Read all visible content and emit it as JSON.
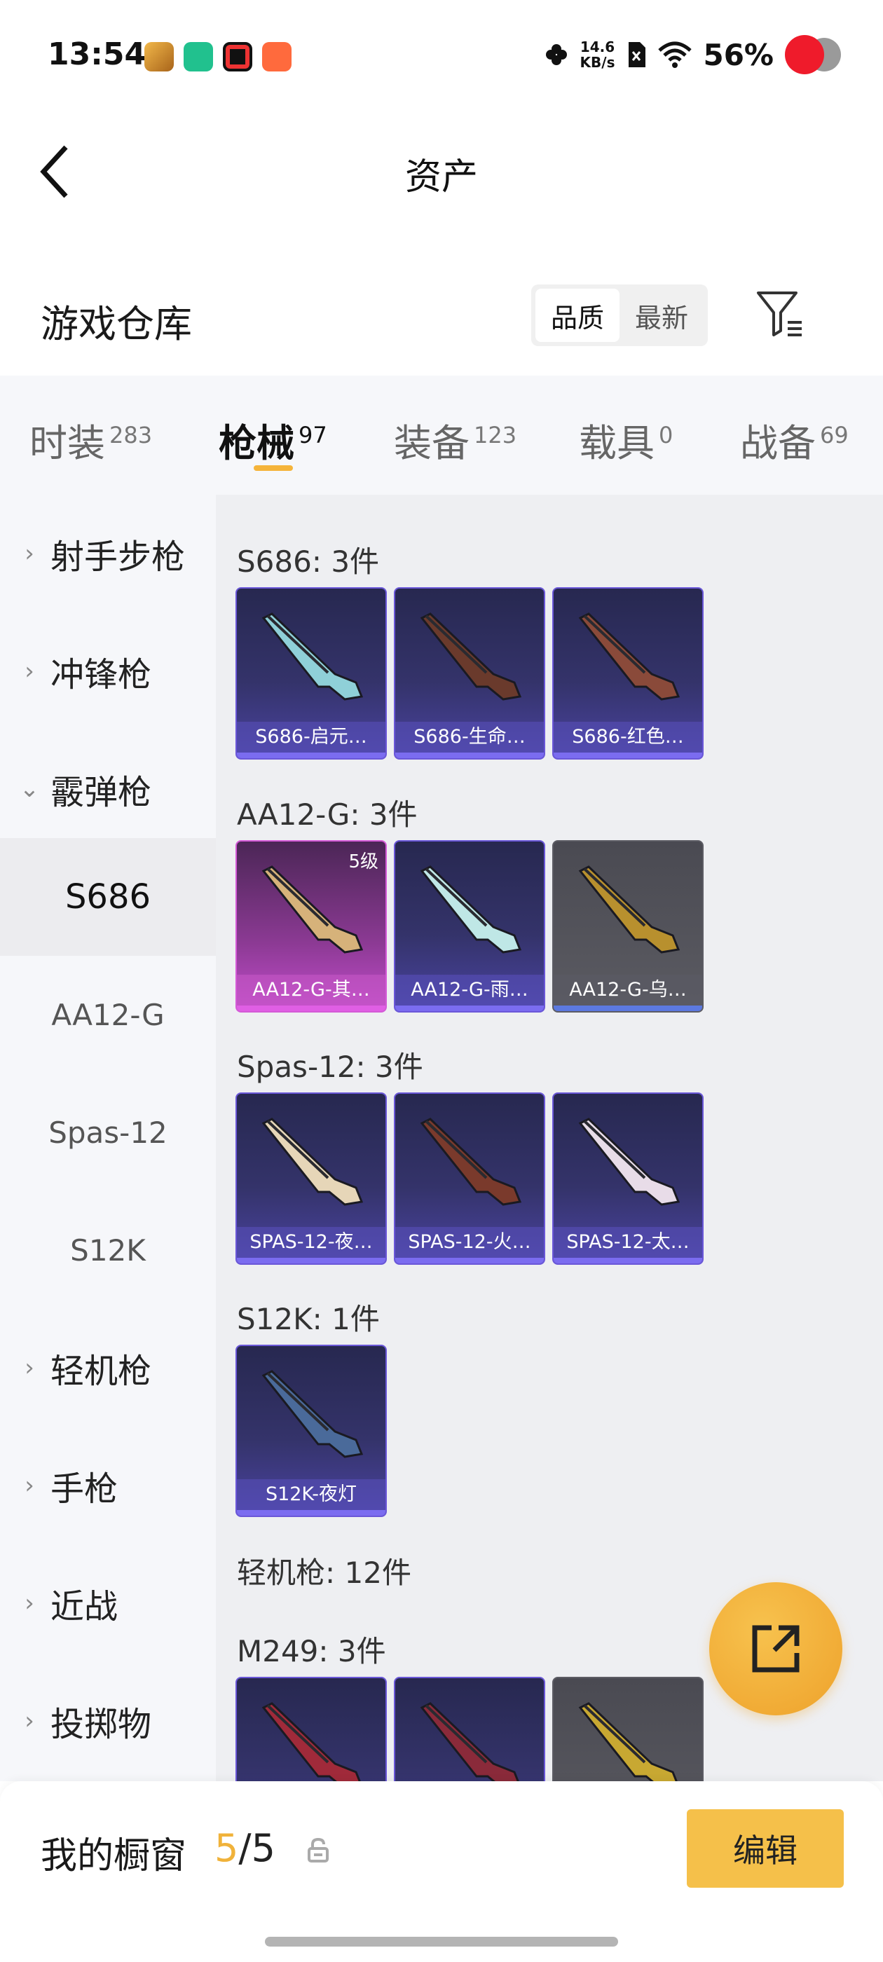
{
  "status_bar": {
    "time": "13:54",
    "net_speed_value": "14.6",
    "net_speed_unit": "KB/s",
    "battery": "56%"
  },
  "header": {
    "title": "资产"
  },
  "warehouse": {
    "title": "游戏仓库",
    "sort_options": [
      "品质",
      "最新"
    ],
    "active_sort": "品质"
  },
  "tabs": [
    {
      "label": "时装",
      "count": "283"
    },
    {
      "label": "枪械",
      "count": "97"
    },
    {
      "label": "装备",
      "count": "123"
    },
    {
      "label": "载具",
      "count": "0"
    },
    {
      "label": "战备",
      "count": "69"
    }
  ],
  "sidebar": {
    "categories": [
      {
        "label": "射手步枪",
        "expanded": false
      },
      {
        "label": "冲锋枪",
        "expanded": false
      },
      {
        "label": "霰弹枪",
        "expanded": true
      },
      {
        "label": "轻机枪",
        "expanded": false
      },
      {
        "label": "手枪",
        "expanded": false
      },
      {
        "label": "近战",
        "expanded": false
      },
      {
        "label": "投掷物",
        "expanded": false
      }
    ],
    "subitems": [
      "S686",
      "AA12-G",
      "Spas-12",
      "S12K"
    ],
    "active_subitem": "S686"
  },
  "groups": [
    {
      "title": "S686: 3件",
      "items": [
        {
          "name": "S686-启元…",
          "rarity": "blue",
          "gun_color": "#8fd0d8"
        },
        {
          "name": "S686-生命…",
          "rarity": "blue",
          "gun_color": "#6a3a2c"
        },
        {
          "name": "S686-红色…",
          "rarity": "blue",
          "gun_color": "#8a4a3a"
        }
      ]
    },
    {
      "title": "AA12-G: 3件",
      "items": [
        {
          "name": "AA12-G-其…",
          "rarity": "purple",
          "gun_color": "#d6b27a",
          "level": "5级"
        },
        {
          "name": "AA12-G-雨…",
          "rarity": "blue",
          "gun_color": "#bfe7e6"
        },
        {
          "name": "AA12-G-乌…",
          "rarity": "gray",
          "gun_color": "#b8902e"
        }
      ]
    },
    {
      "title": "Spas-12: 3件",
      "items": [
        {
          "name": "SPAS-12-夜…",
          "rarity": "blue",
          "gun_color": "#e6d6b8"
        },
        {
          "name": "SPAS-12-火…",
          "rarity": "blue",
          "gun_color": "#7a3a2c"
        },
        {
          "name": "SPAS-12-太…",
          "rarity": "blue",
          "gun_color": "#e8dce8"
        }
      ]
    },
    {
      "title": "S12K: 1件",
      "items": [
        {
          "name": "S12K-夜灯",
          "rarity": "blue",
          "gun_color": "#4a6a9a"
        }
      ]
    },
    {
      "title": "轻机枪: 12件",
      "items": []
    },
    {
      "title": "M249: 3件",
      "items": [
        {
          "name": "",
          "rarity": "blue",
          "gun_color": "#a02a3a"
        },
        {
          "name": "",
          "rarity": "blue",
          "gun_color": "#8a2a3a"
        },
        {
          "name": "",
          "rarity": "gray",
          "gun_color": "#c8a832"
        }
      ]
    }
  ],
  "showcase": {
    "label": "我的橱窗",
    "used": "5",
    "separator": "/",
    "total": "5",
    "edit_label": "编辑"
  },
  "colors": {
    "accent": "#f5b43a",
    "edit_button": "#f5c04a",
    "rarity_blue": "#6a57d8",
    "rarity_purple": "#d45ad7",
    "rarity_gray": "#5c5c64"
  }
}
